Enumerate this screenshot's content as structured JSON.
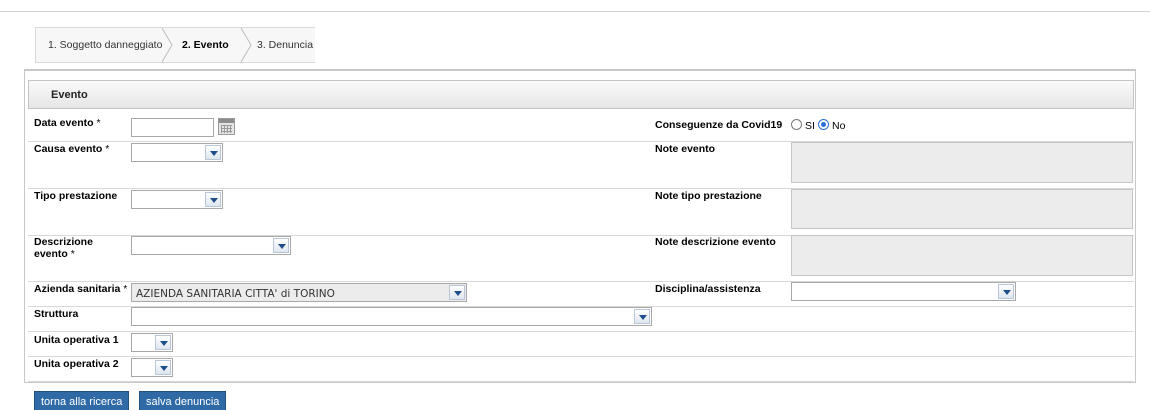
{
  "wizard": {
    "steps": [
      {
        "label": "1. Soggetto danneggiato"
      },
      {
        "label": "2. Evento"
      },
      {
        "label": "3. Denuncia"
      }
    ]
  },
  "section": {
    "title": "Evento"
  },
  "fields": {
    "data_evento": {
      "label": "Data evento",
      "required_mark": "*",
      "value": ""
    },
    "causa_evento": {
      "label": "Causa evento",
      "required_mark": "*",
      "value": ""
    },
    "tipo_prestazione": {
      "label": "Tipo prestazione",
      "value": ""
    },
    "descrizione_evento": {
      "label_line1": "Descrizione",
      "label_line2": "evento",
      "required_mark": "*",
      "value": ""
    },
    "azienda_sanitaria": {
      "label": "Azienda sanitaria",
      "required_mark": "*",
      "value": "AZIENDA SANITARIA CITTA' di TORINO"
    },
    "struttura": {
      "label": "Struttura",
      "value": ""
    },
    "unita_operativa_1": {
      "label": "Unita operativa 1",
      "value": ""
    },
    "unita_operativa_2": {
      "label": "Unita operativa 2",
      "value": ""
    },
    "conseguenze_covid": {
      "label": "Conseguenze da Covid19",
      "option_si": "SI",
      "option_no": "No",
      "selected": "No"
    },
    "note_evento": {
      "label": "Note evento",
      "value": ""
    },
    "note_tipo_prestazione": {
      "label": "Note tipo prestazione",
      "value": ""
    },
    "note_descrizione_evento": {
      "label": "Note descrizione evento",
      "value": ""
    },
    "disciplina_assistenza": {
      "label": "Disciplina/assistenza",
      "value": ""
    }
  },
  "buttons": {
    "torna": "torna alla ricerca",
    "salva": "salva denuncia"
  },
  "colors": {
    "button_bg": "#2f6aa6",
    "radio_accent": "#2b6fd6"
  }
}
